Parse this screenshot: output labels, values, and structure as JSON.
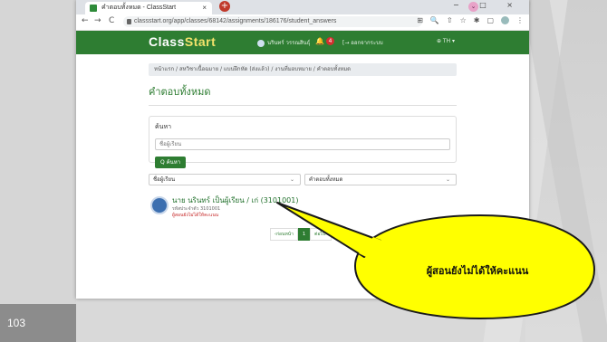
{
  "slide": {
    "number": "103"
  },
  "browser": {
    "tab_title": "คำตอบทั้งหมด - ClassStart",
    "tab_close": "×",
    "new_tab": "+",
    "chevron": "⌄",
    "window_controls": [
      "−",
      "□",
      "×"
    ],
    "url": "classstart.org/app/classes/68142/assignments/186176/student_answers",
    "nav_back": "←",
    "nav_forward": "→",
    "nav_reload": "C",
    "toolbar_icons": [
      "⊞",
      "🔍",
      "⇧",
      "☆",
      "✱",
      "▢",
      "⋮"
    ]
  },
  "site": {
    "brand_part1": "Class",
    "brand_part2": "Start",
    "user_name": "นรินทร์ วรรณสินธุ์",
    "bell": "🔔",
    "notif_count": "4",
    "logout": "[→ ออกจากระบบ",
    "lang": "⊕ TH ▾",
    "colors": {
      "nav": "#2e7d32",
      "brand_accent": "#f3e26b"
    }
  },
  "page": {
    "breadcrumb": "หน้าแรก / สหวิชาเนื้อฉมาย / แบบฝึกหัด (ส่งแล้ว) / งานที่มอบหมาย / คำตอบทั้งหมด",
    "title": "คำตอบทั้งหมด",
    "search": {
      "label": "ค้นหา",
      "placeholder": "ชื่อผู้เรียน",
      "button": "Q ค้นหา"
    },
    "filters": {
      "student_select": "ชื่อผู้เรียน",
      "answer_select": "คำตอบทั้งหมด",
      "chevron": "⌄"
    },
    "student": {
      "name": "นาย นรินทร์ เป็นผู้เรียน / เก่ (3101001)",
      "id_line": "รหัสประจำตัว 3101001",
      "status": "ผู้สอนยังไม่ได้ให้คะแนน"
    },
    "pagination": {
      "prev": "‹ก่อนหน้า",
      "current": "1",
      "next": "ต่อไป›"
    }
  },
  "callout": {
    "text": "ผู้สอนยังไม่ได้ให้คะแนน",
    "fill": "#ffff00",
    "stroke": "#1a1a1a"
  }
}
